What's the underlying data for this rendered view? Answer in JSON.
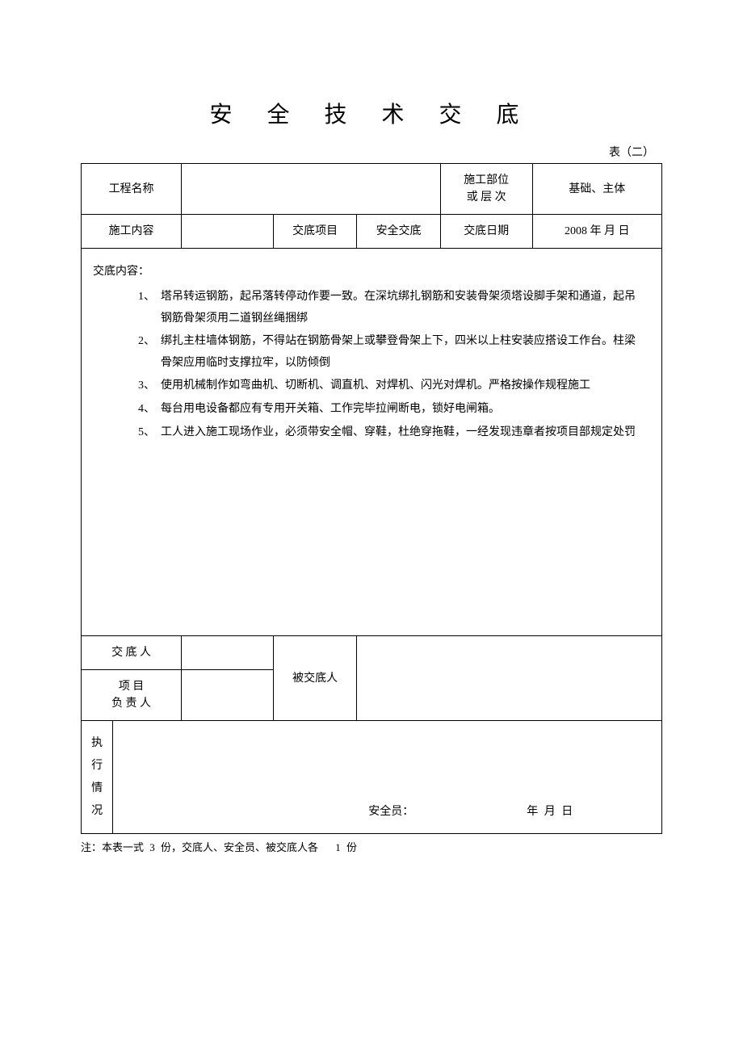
{
  "title": "安 全 技 术 交 底",
  "table_label": "表（二）",
  "row1": {
    "c1": "工程名称",
    "c2": "",
    "c3": "施工部位\n或 层 次",
    "c4": "基础、主体"
  },
  "row2": {
    "c1": "施工内容",
    "c2": "",
    "c3": "交底项目",
    "c4": "安全交底",
    "c5": "交底日期",
    "c6": "2008 年  月   日"
  },
  "content": {
    "header": "交底内容：",
    "items": [
      {
        "n": "1、",
        "text": "塔吊转运钢筋，起吊落转停动作要一致。在深坑绑扎钢筋和安装骨架须塔设脚手架和通道，起吊钢筋骨架须用二道钢丝绳捆绑"
      },
      {
        "n": "2、",
        "text": "绑扎主柱墙体钢筋，不得站在钢筋骨架上或攀登骨架上下，四米以上柱安装应搭设工作台。柱梁骨架应用临时支撑拉牢，以防倾倒"
      },
      {
        "n": "3、",
        "text": "使用机械制作如弯曲机、切断机、调直机、对焊机、闪光对焊机。严格按操作规程施工"
      },
      {
        "n": "4、",
        "text": "每台用电设备都应有专用开关箱、工作完毕拉闸断电，锁好电闸箱。"
      },
      {
        "n": "5、",
        "text": "工人进入施工现场作业，必须带安全帽、穿鞋，杜绝穿拖鞋，一经发现违章者按项目部规定处罚"
      }
    ]
  },
  "sig": {
    "r1": "交 底 人",
    "r2": "项    目\n负 责 人",
    "mid": "被交底人"
  },
  "exec": {
    "label": "执行情况",
    "safety": "安全员：",
    "date": "年     月     日"
  },
  "footnote": {
    "prefix": "注：本表一式",
    "n1": "3",
    "mid": "份，交底人、安全员、被交底人各",
    "n2": "1",
    "suffix": "份"
  }
}
